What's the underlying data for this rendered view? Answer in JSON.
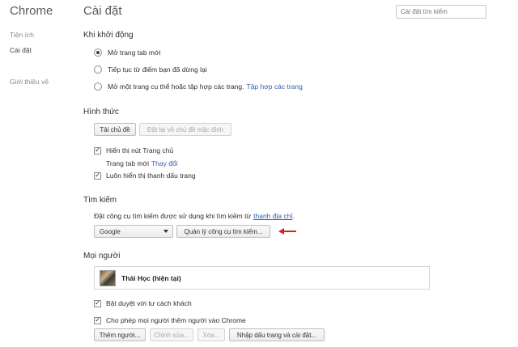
{
  "sidebar": {
    "brand": "Chrome",
    "items": [
      {
        "label": "Tiện ích"
      },
      {
        "label": "Cài đặt"
      },
      {
        "label": "Giới thiệu về"
      }
    ]
  },
  "header": {
    "title": "Cài đặt",
    "search_placeholder": "Cài đặt tìm kiếm"
  },
  "startup": {
    "title": "Khi khởi động",
    "options": [
      {
        "label": "Mở trang tab mới",
        "selected": true
      },
      {
        "label": "Tiếp tục từ điểm bạn đã dừng lại",
        "selected": false
      },
      {
        "label": "Mở một trang cụ thể hoặc tập hợp các trang.",
        "link": "Tập hợp các trang",
        "selected": false
      }
    ]
  },
  "appearance": {
    "title": "Hình thức",
    "get_themes": "Tải chủ đề",
    "reset_theme": "Đặt lại về chủ đề mặc định",
    "show_home": "Hiển thị nút Trang chủ",
    "home_page_text": "Trang tab mới",
    "home_page_change": "Thay đổi",
    "show_bookmarks": "Luôn hiển thị thanh dấu trang"
  },
  "search": {
    "title": "Tìm kiếm",
    "description": "Đặt công cụ tìm kiếm được sử dụng khi tìm kiếm từ",
    "description_link": "thanh địa chỉ",
    "description_end": ".",
    "engine": "Google",
    "manage_button": "Quản lý công cụ tìm kiếm...",
    "annotation_color": "#e02020"
  },
  "people": {
    "title": "Mọi người",
    "current_user": "Thái Học (hiện tại)",
    "guest_browsing": "Bật duyệt với tư cách khách",
    "allow_add": "Cho phép mọi người thêm người vào Chrome",
    "buttons": {
      "add": "Thêm người...",
      "edit": "Chỉnh sửa...",
      "delete": "Xóa...",
      "import": "Nhập dấu trang và cài đặt..."
    }
  }
}
